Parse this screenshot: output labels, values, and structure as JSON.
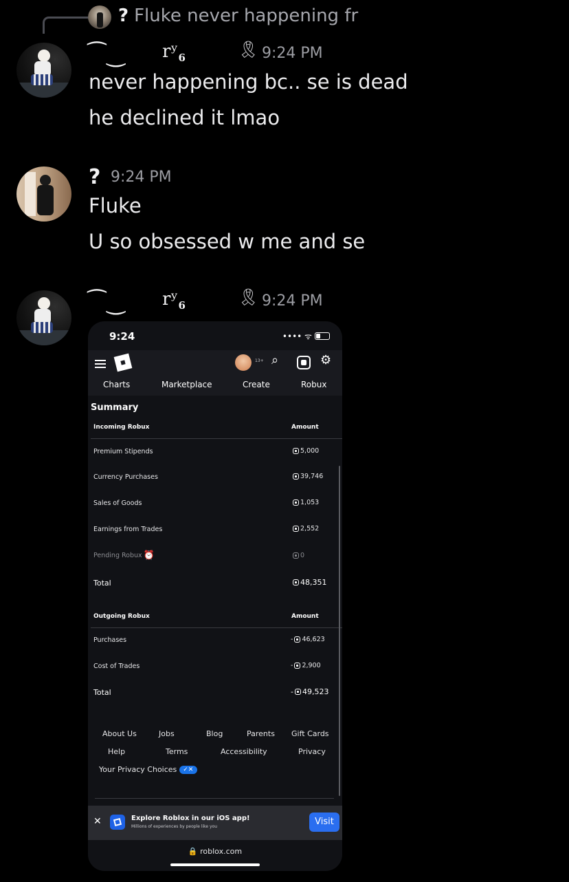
{
  "reply": {
    "author": "?",
    "text": "Fluke never happening fr"
  },
  "messages": [
    {
      "author_glyph": "⁀‿",
      "author_suffix": "rʸ",
      "author_sub": "6",
      "badge": "🎗",
      "time": "9:24 PM",
      "lines": [
        "never happening bc.. se is dead",
        "he declined it lmao"
      ]
    },
    {
      "author_glyph": "?",
      "time": "9:24 PM",
      "lines": [
        "Fluke",
        "U so obsessed w me and se"
      ]
    },
    {
      "author_glyph": "⁀‿",
      "author_suffix": "rʸ",
      "author_sub": "6",
      "badge": "🎗",
      "time": "9:24 PM",
      "lines": []
    }
  ],
  "screenshot": {
    "status_time": "9:24",
    "status_icons": "•••• ᯤ",
    "nav": {
      "age": "13+",
      "tabs": [
        "Charts",
        "Marketplace",
        "Create",
        "Robux"
      ]
    },
    "summary_title": "Summary",
    "incoming": {
      "header": "Incoming Robux",
      "amount_header": "Amount",
      "rows": [
        {
          "label": "Premium Stipends",
          "amount": "5,000"
        },
        {
          "label": "Currency Purchases",
          "amount": "39,746"
        },
        {
          "label": "Sales of Goods",
          "amount": "1,053"
        },
        {
          "label": "Earnings from Trades",
          "amount": "2,552"
        },
        {
          "label": "Pending Robux",
          "amount": "0"
        }
      ],
      "total_label": "Total",
      "total": "48,351"
    },
    "outgoing": {
      "header": "Outgoing Robux",
      "amount_header": "Amount",
      "rows": [
        {
          "label": "Purchases",
          "amount": "46,623"
        },
        {
          "label": "Cost of Trades",
          "amount": "2,900"
        }
      ],
      "total_label": "Total",
      "total": "49,523"
    },
    "footer": {
      "row1": [
        "About Us",
        "Jobs",
        "Blog",
        "Parents",
        "Gift Cards"
      ],
      "row2": [
        "Help",
        "Terms",
        "Accessibility",
        "Privacy"
      ],
      "privacy_choices": "Your Privacy Choices"
    },
    "banner": {
      "title": "Explore Roblox in our iOS app!",
      "subtitle": "Millions of experiences by people like you",
      "button": "Visit"
    },
    "url": "roblox.com"
  }
}
